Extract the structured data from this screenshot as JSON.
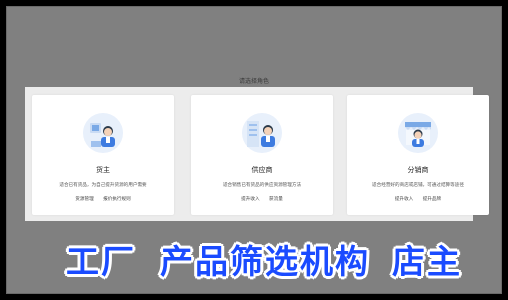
{
  "page": {
    "heading": "请选择角色"
  },
  "cards": [
    {
      "title": "货主",
      "description": "适合已有货品，为自己提升货源的用户需要",
      "tags": [
        "货源管理",
        "报价执行规则"
      ]
    },
    {
      "title": "供应商",
      "description": "适合销售已有货品的供应资源管理方法",
      "tags": [
        "提升收入",
        "获流量"
      ]
    },
    {
      "title": "分销商",
      "description": "适合经营好的商店或店铺，可通过结算等途径",
      "tags": [
        "提升收入",
        "提升品牌"
      ]
    }
  ],
  "caption": {
    "left": "工厂",
    "middle": "产品筛选机构",
    "right": "店主"
  },
  "colors": {
    "caption_text": "#1a4bff",
    "caption_outline": "#ffffff",
    "background": "#808080",
    "panel": "#ececec",
    "card": "#ffffff",
    "illustration_circle": "#e8f0fb"
  }
}
